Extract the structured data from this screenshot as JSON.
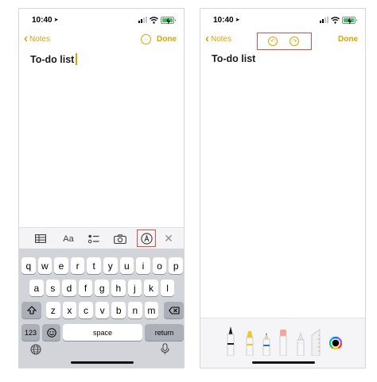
{
  "status": {
    "time": "10:40"
  },
  "nav": {
    "back_label": "Notes",
    "done_label": "Done"
  },
  "note": {
    "title": "To-do list"
  },
  "toolbar": {
    "format_label": "Aa"
  },
  "keyboard": {
    "row1": [
      "q",
      "w",
      "e",
      "r",
      "t",
      "y",
      "u",
      "i",
      "o",
      "p"
    ],
    "row2": [
      "a",
      "s",
      "d",
      "f",
      "g",
      "h",
      "j",
      "k",
      "l"
    ],
    "row3": [
      "z",
      "x",
      "c",
      "v",
      "b",
      "n",
      "m"
    ],
    "numbers_label": "123",
    "space_label": "space",
    "return_label": "return"
  },
  "colors": {
    "accent": "#d9a400",
    "highlight": "#e74c3c",
    "keyboard_bg": "#d2d4d9"
  },
  "icons": [
    "location-arrow-icon",
    "signal-icon",
    "wifi-icon",
    "battery-icon",
    "chevron-left-icon",
    "more-icon",
    "undo-icon",
    "redo-icon",
    "table-icon",
    "checklist-icon",
    "camera-icon",
    "markup-icon",
    "close-icon",
    "shift-icon",
    "delete-icon",
    "emoji-icon",
    "globe-icon",
    "microphone-icon",
    "pen-icon",
    "marker-icon",
    "pencil-icon",
    "eraser-icon",
    "lasso-icon",
    "ruler-icon",
    "color-picker-icon"
  ]
}
